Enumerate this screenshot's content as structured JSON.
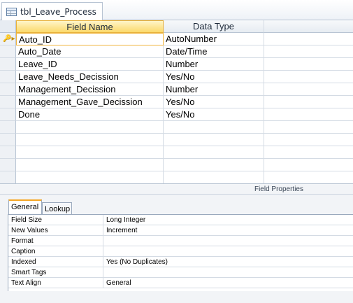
{
  "window": {
    "title": "tbl_Leave_Process"
  },
  "grid": {
    "columns": {
      "field_name": "Field Name",
      "data_type": "Data Type"
    },
    "rows": [
      {
        "field": "Auto_ID",
        "type": "AutoNumber",
        "primary_key": true
      },
      {
        "field": "Auto_Date",
        "type": "Date/Time"
      },
      {
        "field": "Leave_ID",
        "type": "Number"
      },
      {
        "field": "Leave_Needs_Decission",
        "type": "Yes/No"
      },
      {
        "field": "Management_Decission",
        "type": "Number"
      },
      {
        "field": "Management_Gave_Decission",
        "type": "Yes/No"
      },
      {
        "field": "Done",
        "type": "Yes/No"
      }
    ]
  },
  "field_properties": {
    "label": "Field Properties",
    "tabs": [
      "General",
      "Lookup"
    ],
    "active_tab": "General",
    "rows": [
      {
        "name": "Field Size",
        "value": "Long Integer"
      },
      {
        "name": "New Values",
        "value": "Increment"
      },
      {
        "name": "Format",
        "value": ""
      },
      {
        "name": "Caption",
        "value": ""
      },
      {
        "name": "Indexed",
        "value": "Yes (No Duplicates)"
      },
      {
        "name": "Smart Tags",
        "value": ""
      },
      {
        "name": "Text Align",
        "value": "General"
      }
    ]
  },
  "icons": {
    "table": "table-icon",
    "primary_key": "key-icon"
  }
}
